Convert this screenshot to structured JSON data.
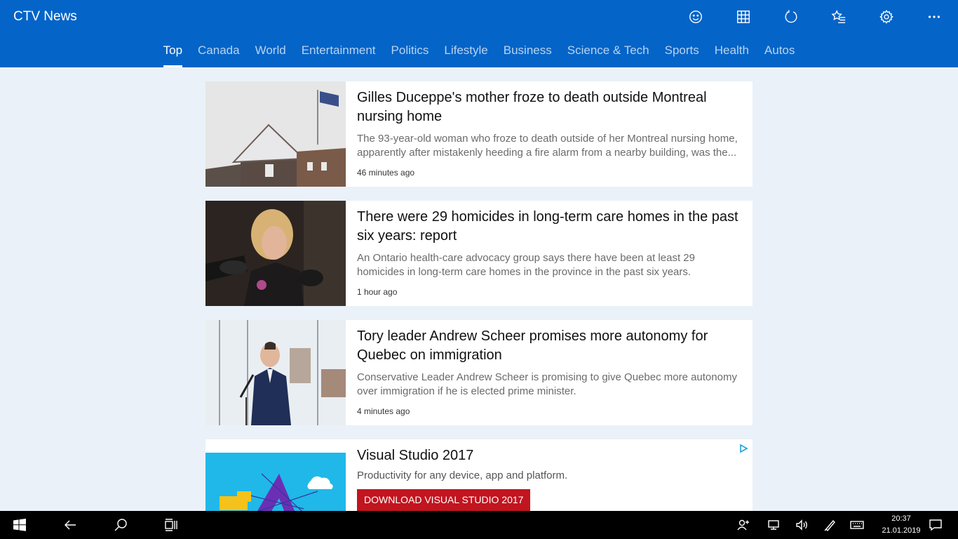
{
  "app": {
    "title": "CTV News"
  },
  "header_icons": [
    "smiley-icon",
    "grid-icon",
    "refresh-icon",
    "favorites-icon",
    "settings-icon",
    "more-icon"
  ],
  "tabs": [
    {
      "label": "Top",
      "active": true
    },
    {
      "label": "Canada"
    },
    {
      "label": "World"
    },
    {
      "label": "Entertainment"
    },
    {
      "label": "Politics"
    },
    {
      "label": "Lifestyle"
    },
    {
      "label": "Business"
    },
    {
      "label": "Science & Tech"
    },
    {
      "label": "Sports"
    },
    {
      "label": "Health"
    },
    {
      "label": "Autos"
    }
  ],
  "articles": [
    {
      "headline": "Gilles Duceppe's mother froze to death outside Montreal nursing home",
      "summary": "The 93-year-old woman who froze to death outside of her Montreal nursing home, apparently after mistakenly heeding a fire alarm from a nearby building, was the...",
      "time": "46 minutes ago"
    },
    {
      "headline": "There were 29 homicides in long-term care homes in the past six years: report",
      "summary": "An Ontario health-care advocacy group says there have been at least 29 homicides in long-term care homes in the province in the past six years.",
      "time": "1 hour ago"
    },
    {
      "headline": "Tory leader Andrew Scheer promises more autonomy for Quebec on immigration",
      "summary": "Conservative Leader Andrew Scheer is promising to give Quebec more autonomy over immigration if he is elected prime minister.",
      "time": "4 minutes ago"
    }
  ],
  "ad": {
    "title": "Visual Studio 2017",
    "subtitle": "Productivity for any device, app and platform.",
    "button_label": "DOWNLOAD VISUAL STUDIO 2017"
  },
  "taskbar": {
    "time": "20:37",
    "date": "21.01.2019"
  },
  "colors": {
    "header_bg": "#0464c8",
    "page_bg": "#eaf1f8",
    "ad_button": "#c1151f"
  }
}
